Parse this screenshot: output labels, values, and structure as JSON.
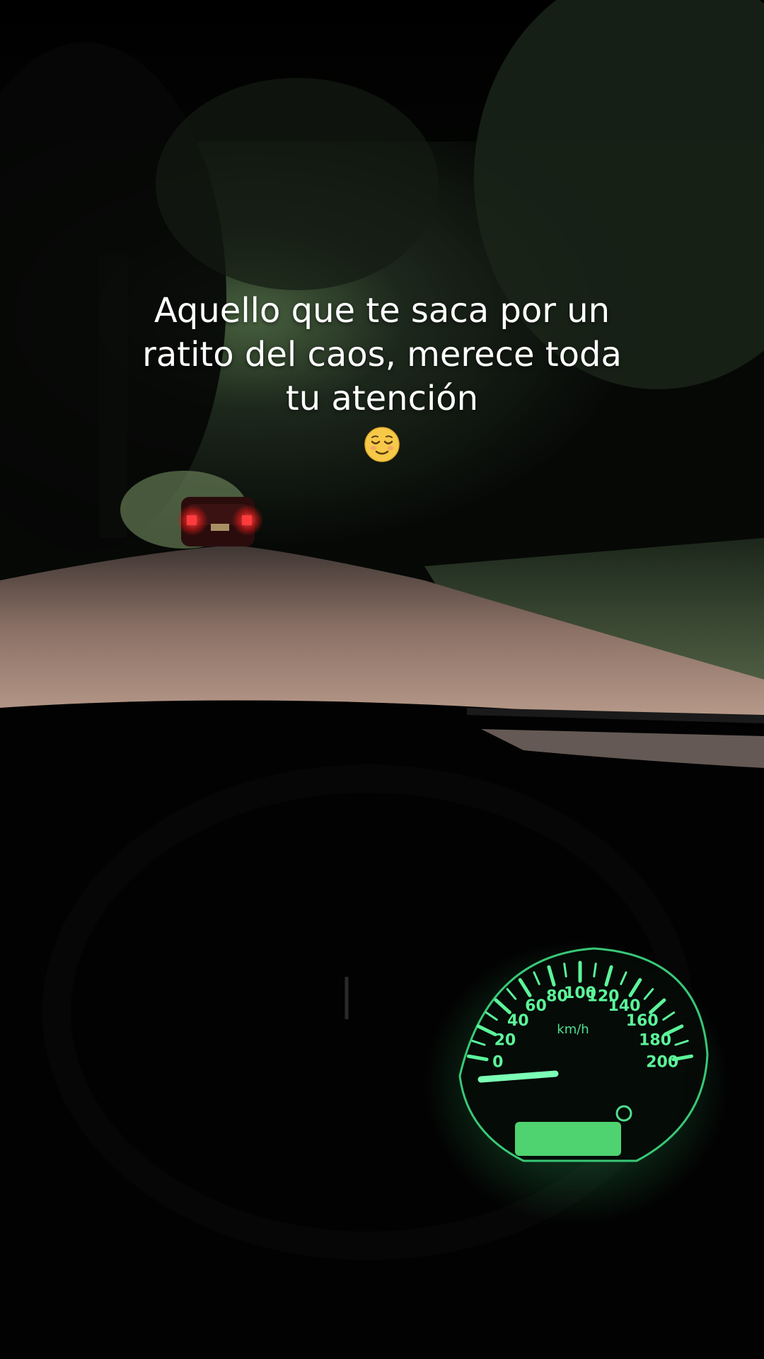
{
  "caption": {
    "line1": "Aquello que te saca por un",
    "line2": "ratito del caos, merece toda",
    "line3": "tu atención",
    "emoji_icon": "relieved-face-emoji"
  },
  "speedometer": {
    "unit": "km/h",
    "labels": [
      "0",
      "20",
      "40",
      "60",
      "80",
      "100",
      "120",
      "140",
      "160",
      "180",
      "200"
    ],
    "needle_kmh": 0,
    "glow_color": "#5cf59a"
  },
  "scene": {
    "description_colors": {
      "road": "#8a6e62",
      "taillights": "#ff2a2a",
      "foliage": "#1e2b1c"
    }
  }
}
